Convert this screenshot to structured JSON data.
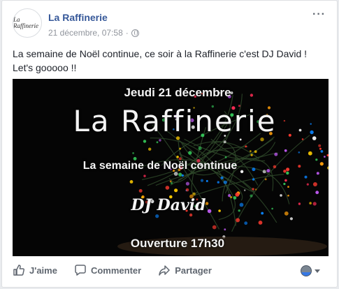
{
  "post": {
    "page_name": "La Raffinerie",
    "timestamp": "21 décembre, 07:58",
    "separator": "·",
    "avatar_logo": "La Raffinerie",
    "text_line1": "La semaine de Noël continue, ce soir à la Raffinerie c'est DJ David !",
    "text_line2": "Let's gooooo !!"
  },
  "image": {
    "line1": "Jeudi 21 décembre",
    "line2": "La Raffinerie",
    "line3": "La  semaine de Noël continue",
    "line4": "DJ David",
    "line5": "Ouverture 17h30"
  },
  "actions": {
    "like_label": "J'aime",
    "comment_label": "Commenter",
    "share_label": "Partager"
  },
  "icons": [
    "more-options-icon",
    "globe-icon",
    "thumbs-up-icon",
    "comment-icon",
    "share-icon",
    "audience-avatar-icon",
    "caret-down-icon"
  ]
}
